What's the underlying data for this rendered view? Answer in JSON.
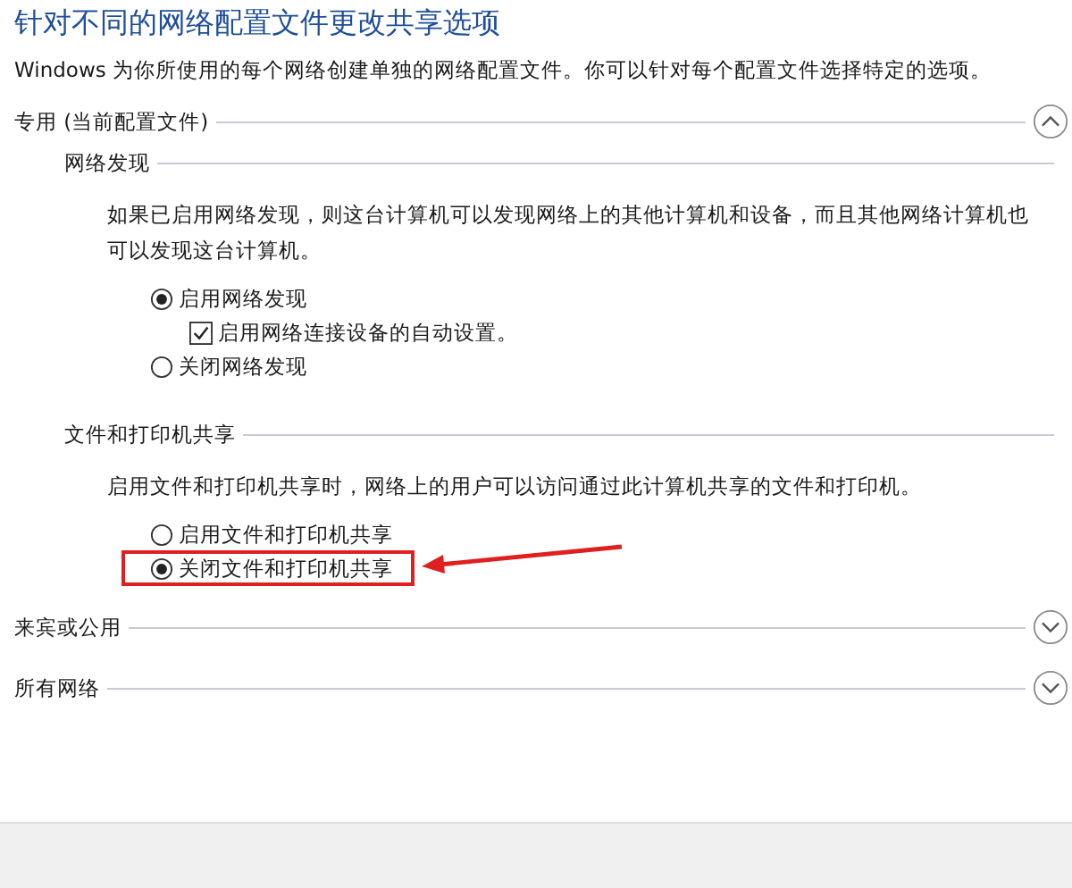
{
  "title": "针对不同的网络配置文件更改共享选项",
  "description": "Windows 为你所使用的每个网络创建单独的网络配置文件。你可以针对每个配置文件选择特定的选项。",
  "profiles": [
    {
      "label": "专用 (当前配置文件)",
      "expanded": true,
      "groups": [
        {
          "heading": "网络发现",
          "text": "如果已启用网络发现，则这台计算机可以发现网络上的其他计算机和设备，而且其他网络计算机也可以发现这台计算机。",
          "options": [
            {
              "kind": "radio",
              "label": "启用网络发现",
              "selected": true
            },
            {
              "kind": "checkbox",
              "label": "启用网络连接设备的自动设置。",
              "checked": true
            },
            {
              "kind": "radio",
              "label": "关闭网络发现",
              "selected": false
            }
          ]
        },
        {
          "heading": "文件和打印机共享",
          "text": "启用文件和打印机共享时，网络上的用户可以访问通过此计算机共享的文件和打印机。",
          "options": [
            {
              "kind": "radio",
              "label": "启用文件和打印机共享",
              "selected": false
            },
            {
              "kind": "radio",
              "label": "关闭文件和打印机共享",
              "selected": true,
              "highlighted": true
            }
          ]
        }
      ]
    },
    {
      "label": "来宾或公用",
      "expanded": false
    },
    {
      "label": "所有网络",
      "expanded": false
    }
  ]
}
